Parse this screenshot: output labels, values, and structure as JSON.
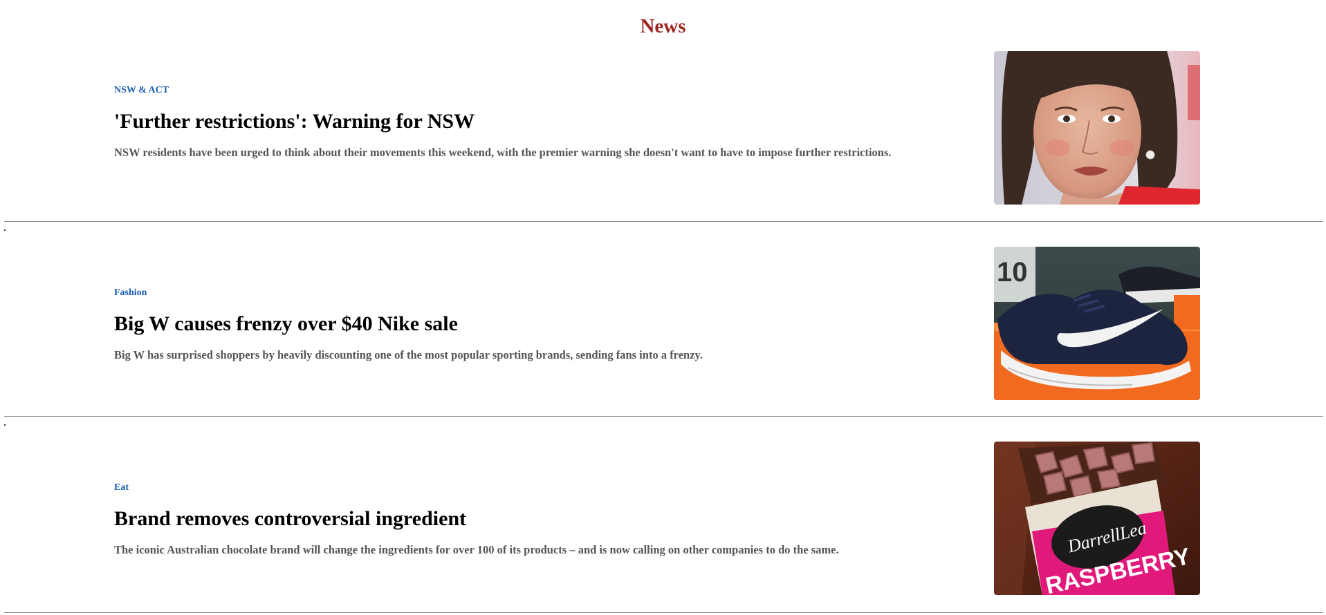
{
  "page": {
    "title": "News"
  },
  "articles": [
    {
      "category": "NSW & ACT",
      "headline": "'Further restrictions': Warning for NSW",
      "summary": "NSW residents have been urged to think about their movements this weekend, with the premier warning she doesn't want to have to impose further restrictions.",
      "image_icon": "premier-portrait"
    },
    {
      "category": "Fashion",
      "headline": "Big W causes frenzy over $40 Nike sale",
      "summary": "Big W has surprised shoppers by heavily discounting one of the most popular sporting brands, sending fans into a frenzy.",
      "image_icon": "nike-shoe"
    },
    {
      "category": "Eat",
      "headline": "Brand removes controversial ingredient",
      "summary": "The iconic Australian chocolate brand will change the ingredients for over 100 of its products – and is now calling on other companies to do the same.",
      "image_icon": "chocolate-pack",
      "image_text": {
        "brand": "DarrellLea",
        "flavour": "RASPBERRY"
      }
    }
  ],
  "colors": {
    "title": "#9b2520",
    "category": "#1a5fb4",
    "summary": "#555555",
    "divider": "#8a8a8a"
  }
}
